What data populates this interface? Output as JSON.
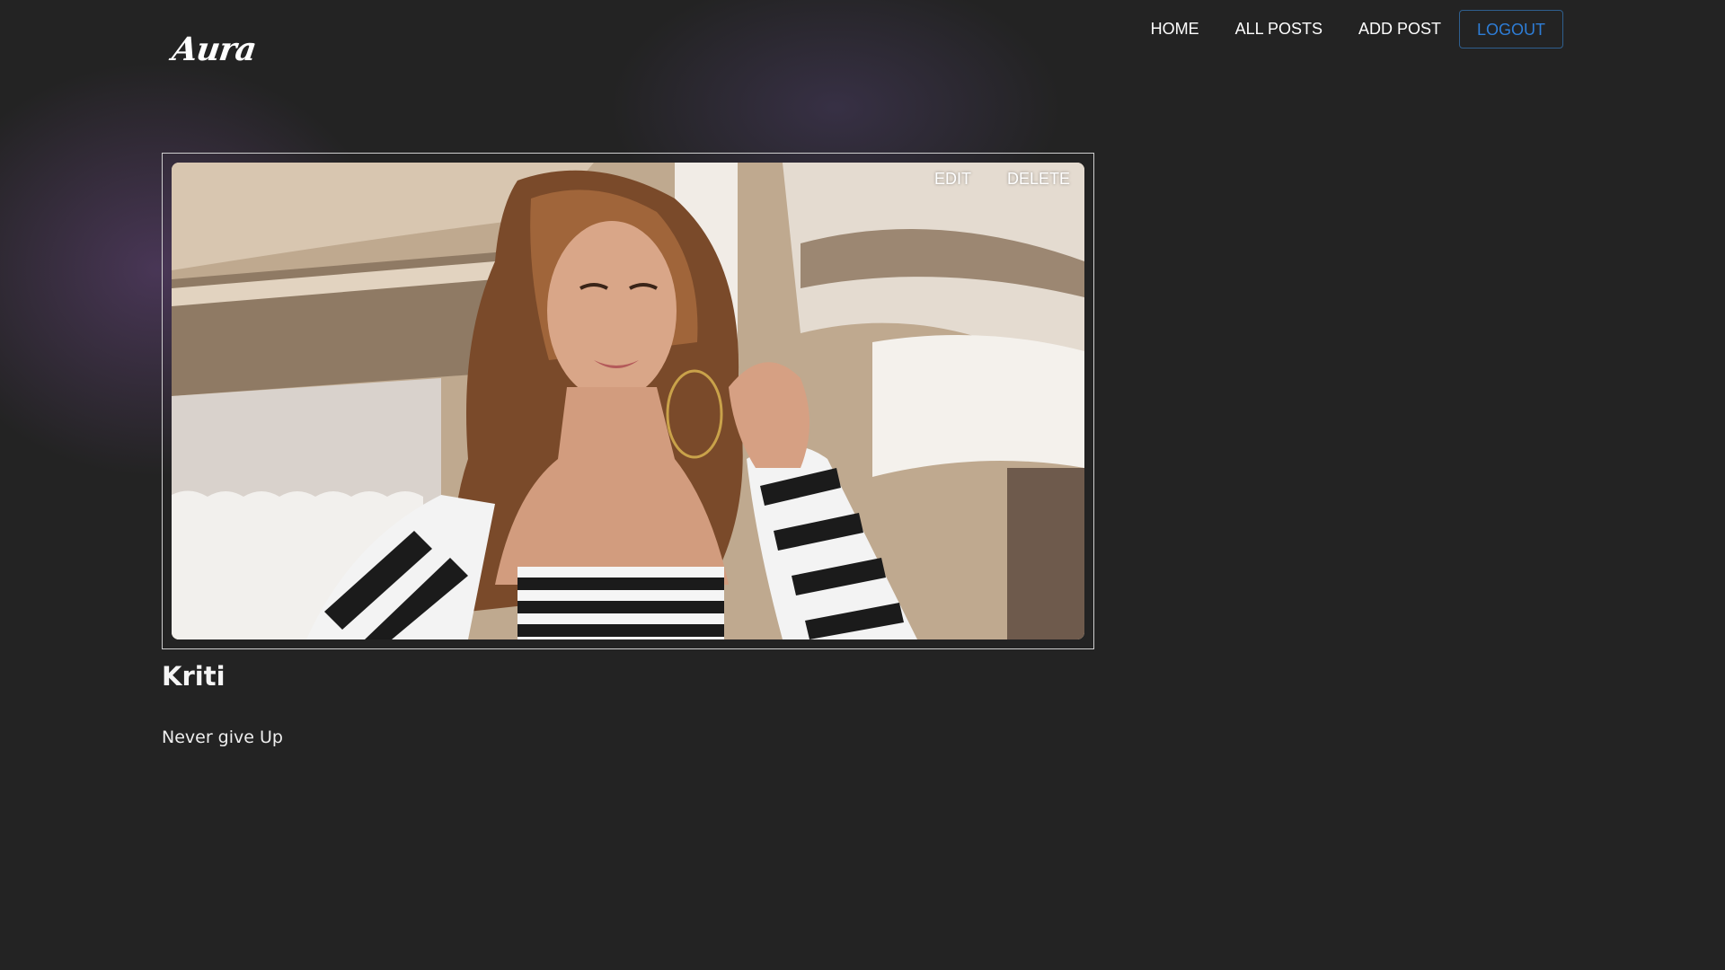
{
  "brand": {
    "logo_text": "Aura"
  },
  "nav": {
    "items": [
      {
        "label": "HOME"
      },
      {
        "label": "ALL POSTS"
      },
      {
        "label": "ADD POST"
      }
    ],
    "logout_label": "LOGOUT"
  },
  "post": {
    "image_icon": "post-photo",
    "edit_label": "EDIT",
    "delete_label": "DELETE",
    "title": "Kriti",
    "body": "Never give Up"
  },
  "colors": {
    "background": "#232323",
    "logout_text": "#2e7dd6",
    "logout_border": "#2f5f8e"
  }
}
